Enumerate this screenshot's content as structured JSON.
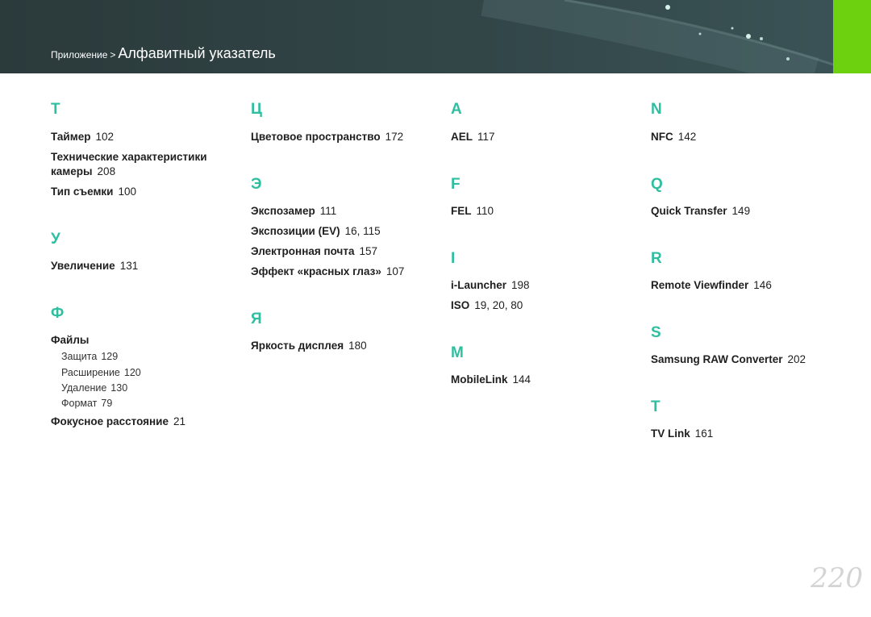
{
  "header": {
    "section": "Приложение",
    "separator": ">",
    "current": "Алфавитный указатель"
  },
  "columns": [
    {
      "groups": [
        {
          "letter": "Т",
          "entries": [
            {
              "text": "Таймер",
              "page": "102"
            },
            {
              "text": "Технические характеристики",
              "page": ""
            },
            {
              "text": "камеры",
              "page": "208"
            },
            {
              "text": "Тип съемки",
              "page": "100"
            }
          ]
        },
        {
          "letter": "У",
          "entries": [
            {
              "text": "Увеличение",
              "page": "131"
            }
          ]
        },
        {
          "letter": "Ф",
          "entries": [
            {
              "text": "Файлы",
              "page": ""
            }
          ],
          "subentries": [
            {
              "text": "Защита",
              "page": "129"
            },
            {
              "text": "Расширение",
              "page": "120"
            },
            {
              "text": "Удаление",
              "page": "130"
            },
            {
              "text": "Формат",
              "page": "79"
            }
          ],
          "after": [
            {
              "text": "Фокусное расстояние",
              "page": "21"
            }
          ]
        }
      ]
    },
    {
      "groups": [
        {
          "letter": "Ц",
          "entries": [
            {
              "text": "Цветовое пространство",
              "page": "172"
            }
          ]
        },
        {
          "letter": "Э",
          "entries": [
            {
              "text": "Экспозамер",
              "page": "111"
            },
            {
              "text": "Экспозиции (EV)",
              "page": "16, 115"
            },
            {
              "text": "Электронная почта",
              "page": "157"
            },
            {
              "text": "Эффект «красных глаз»",
              "page": "107"
            }
          ]
        },
        {
          "letter": "Я",
          "entries": [
            {
              "text": "Яркость дисплея",
              "page": "180"
            }
          ]
        }
      ]
    },
    {
      "groups": [
        {
          "letter": "A",
          "entries": [
            {
              "text": "AEL",
              "page": "117"
            }
          ]
        },
        {
          "letter": "F",
          "entries": [
            {
              "text": "FEL",
              "page": "110"
            }
          ]
        },
        {
          "letter": "I",
          "entries": [
            {
              "text": "i-Launcher",
              "page": "198"
            },
            {
              "text": "ISO",
              "page": "19, 20, 80"
            }
          ]
        },
        {
          "letter": "M",
          "entries": [
            {
              "text": "MobileLink",
              "page": "144"
            }
          ]
        }
      ]
    },
    {
      "groups": [
        {
          "letter": "N",
          "entries": [
            {
              "text": "NFC",
              "page": "142"
            }
          ]
        },
        {
          "letter": "Q",
          "entries": [
            {
              "text": "Quick Transfer",
              "page": "149"
            }
          ]
        },
        {
          "letter": "R",
          "entries": [
            {
              "text": "Remote Viewfinder",
              "page": "146"
            }
          ]
        },
        {
          "letter": "S",
          "entries": [
            {
              "text": "Samsung RAW Converter",
              "page": "202"
            }
          ]
        },
        {
          "letter": "T",
          "entries": [
            {
              "text": "TV Link",
              "page": "161"
            }
          ]
        }
      ]
    }
  ],
  "page_number": "220",
  "colors": {
    "accent": "#2fbfa0",
    "header_bg": "#2f4143",
    "tab": "#6ed10f"
  }
}
